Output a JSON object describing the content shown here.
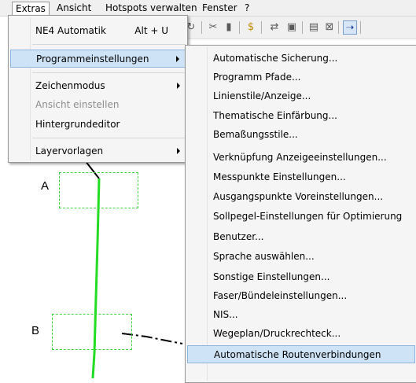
{
  "menubar": {
    "items": [
      {
        "label": "Extras",
        "active": true
      },
      {
        "label": "Ansicht"
      },
      {
        "label": "Hotspots verwalten"
      },
      {
        "label": "Fenster"
      },
      {
        "label": "?"
      }
    ]
  },
  "canvas": {
    "labels": [
      "A",
      "B"
    ],
    "line_color": "#22dd22",
    "hotspot_color": "#3cd33c"
  },
  "extras_menu": {
    "items": [
      {
        "label": "NE4 Automatik",
        "shortcut": "Alt + U"
      },
      {
        "label": "Programmeinstellungen",
        "submenu": true,
        "highlighted": true
      },
      {
        "label": "Zeichenmodus",
        "submenu": true
      },
      {
        "label": "Ansicht einstellen",
        "disabled": true
      },
      {
        "label": "Hintergrundeditor"
      },
      {
        "label": "Layervorlagen",
        "submenu": true
      }
    ]
  },
  "settings_submenu": {
    "items": [
      {
        "label": "Automatische Sicherung..."
      },
      {
        "label": "Programm Pfade..."
      },
      {
        "label": "Linienstile/Anzeige..."
      },
      {
        "label": "Thematische Einfärbung..."
      },
      {
        "label": "Bemaßungsstile..."
      },
      {
        "label": "Verknüpfung Anzeigeeinstellungen..."
      },
      {
        "label": "Messpunkte Einstellungen..."
      },
      {
        "label": "Ausgangspunkte Voreinstellungen..."
      },
      {
        "label": "Sollpegel-Einstellungen für Optimierung"
      },
      {
        "label": "Benutzer..."
      },
      {
        "label": "Sprache auswählen..."
      },
      {
        "label": "Sonstige Einstellungen..."
      },
      {
        "label": "Faser/Bündeleinstellungen..."
      },
      {
        "label": "NIS..."
      },
      {
        "label": "Wegeplan/Druckrechteck..."
      },
      {
        "label": "Automatische Routenverbindungen",
        "highlighted": true
      }
    ]
  },
  "colors": {
    "highlight_bg": "#cfe3f7",
    "highlight_border": "#8cb6e0",
    "menu_bg": "#f5f5f5"
  }
}
